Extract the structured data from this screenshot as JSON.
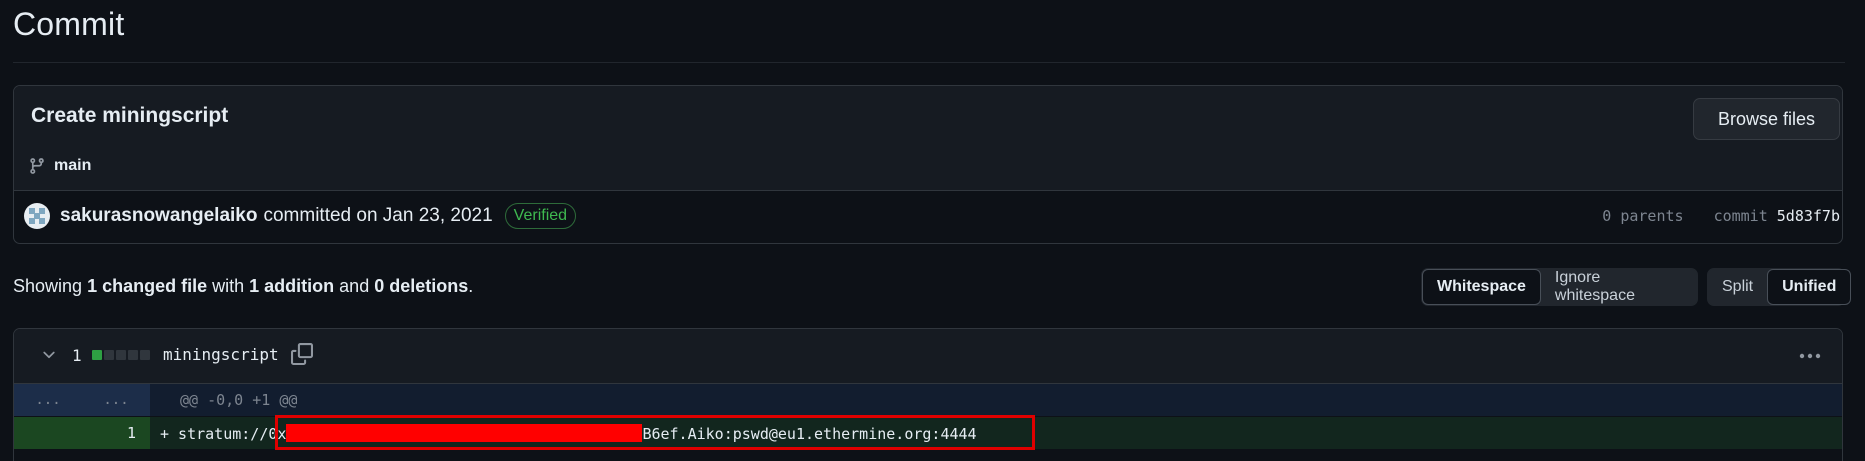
{
  "page": {
    "title": "Commit"
  },
  "commit": {
    "message": "Create miningscript",
    "browse_label": "Browse files",
    "branch": "main",
    "author": "sakurasnowangelaiko",
    "action": "committed on Jan 23, 2021",
    "verified_label": "Verified",
    "parents": "0 parents",
    "commit_label": "commit",
    "sha": "5d83f7b"
  },
  "summary": {
    "prefix": "Showing",
    "files": "1 changed file",
    "mid1": "with",
    "additions": "1 addition",
    "mid2": "and",
    "deletions": "0 deletions",
    "suffix": "."
  },
  "toggles": {
    "whitespace": "Whitespace",
    "ignore_whitespace": "Ignore whitespace",
    "split": "Split",
    "unified": "Unified"
  },
  "file": {
    "change_count": "1",
    "name": "miningscript",
    "diffstat": [
      "add",
      "neutral",
      "neutral",
      "neutral",
      "neutral"
    ],
    "hunk_gutter_left": "...",
    "hunk_gutter_right": "...",
    "hunk_header": "@@ -0,0 +1 @@",
    "line_number": "1",
    "line_prefix": "+ stratum://0x",
    "line_suffix": "B6ef.Aiko:pswd@eu1.ethermine.org:4444"
  },
  "colors": {
    "background": "#0d1117",
    "verified": "#3fb950",
    "addition_bg": "#12261e",
    "redaction": "#ff0000"
  }
}
